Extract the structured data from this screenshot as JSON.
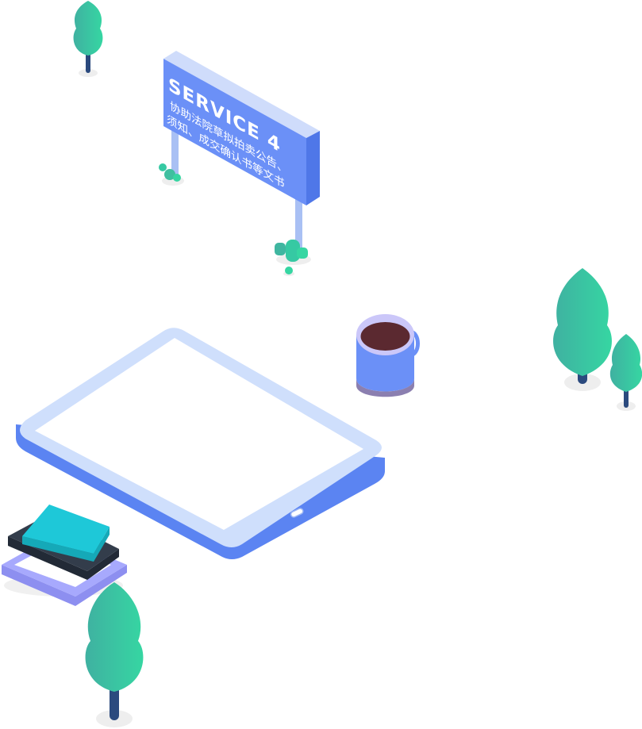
{
  "sign": {
    "title": "SERVICE 4",
    "line1": "协助法院草拟拍卖公告、",
    "line2": "须知、成交确认书等文书"
  },
  "colors": {
    "tree_gradient_start": "#3fb6a0",
    "tree_gradient_end": "#35d5a2",
    "trunk": "#2b4a7e",
    "sign_face": "#6b90f7",
    "sign_top": "#cfdcfb",
    "sign_post": "#a9c0f4",
    "tablet_frame": "#cfdffc",
    "tablet_side": "#5b84f2",
    "mug_body": "#6b90f7",
    "coffee": "#5b2930",
    "book_top": "#1ec8d8",
    "book_middle": "#333d4b",
    "book_bottom": "#a7a9fd",
    "shadow": "#eeeeee"
  },
  "icons": [
    "tree-icon",
    "signboard-icon",
    "tablet-icon",
    "coffee-mug-icon",
    "book-stack-icon"
  ]
}
